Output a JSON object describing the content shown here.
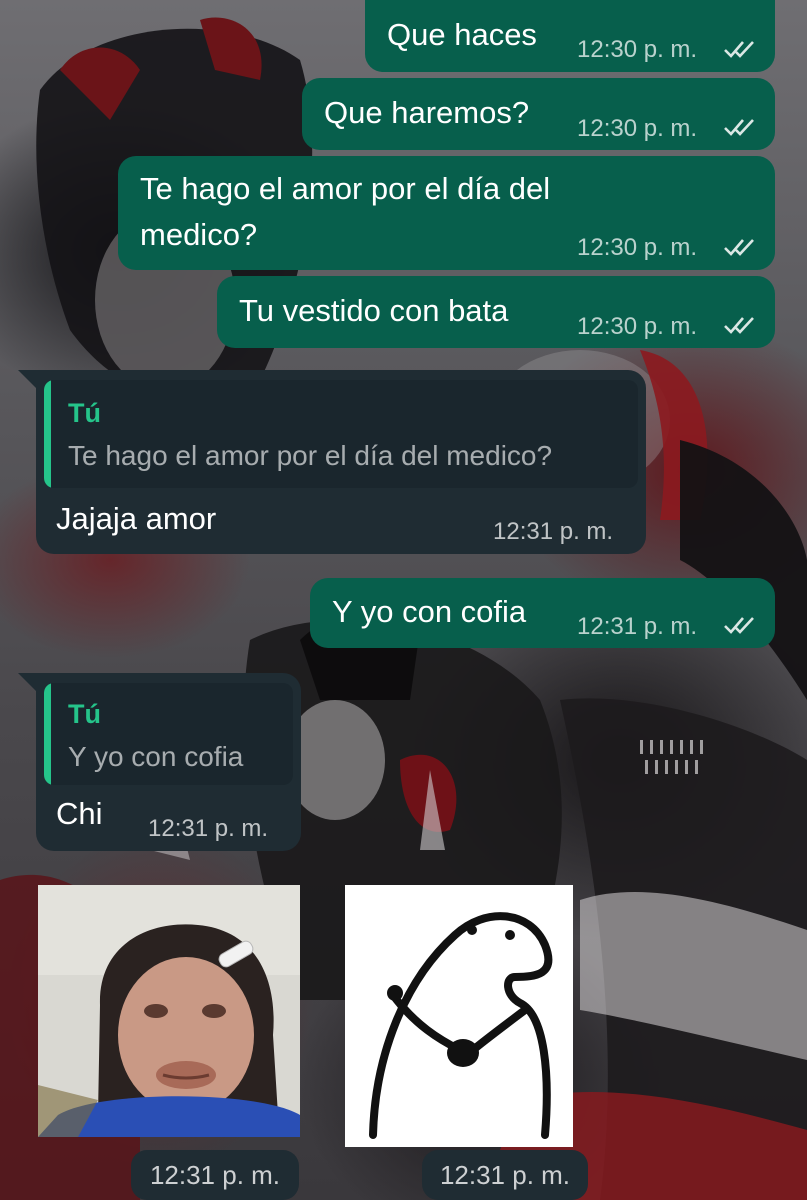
{
  "messages": [
    {
      "text": "Que haces",
      "time": "12:30 p. m."
    },
    {
      "text": "Que haremos?",
      "time": "12:30 p. m."
    },
    {
      "line1": "Te hago el amor por el día del",
      "line2": "medico?",
      "time": "12:30 p. m."
    },
    {
      "text": "Tu vestido con bata",
      "time": "12:30 p. m."
    },
    {
      "quote_author": "Tú",
      "quote_text": "Te hago el amor por el día del medico?",
      "text": "Jajaja amor",
      "time": "12:31 p. m."
    },
    {
      "text": "Y yo con cofia",
      "time": "12:31 p. m."
    },
    {
      "quote_author": "Tú",
      "quote_text": "Y yo con cofia",
      "text": "Chi",
      "time": "12:31 p. m."
    }
  ],
  "stickers": [
    {
      "icon": "photo-sticker-face",
      "time": "12:31 p. m."
    },
    {
      "icon": "flork-sticker",
      "time": "12:31 p. m."
    }
  ],
  "colors": {
    "outgoing_bubble": "#075f4c",
    "incoming_bubble": "#1f2c33",
    "quote_accent": "#25c48a",
    "read_ticks": "#ffffff"
  }
}
